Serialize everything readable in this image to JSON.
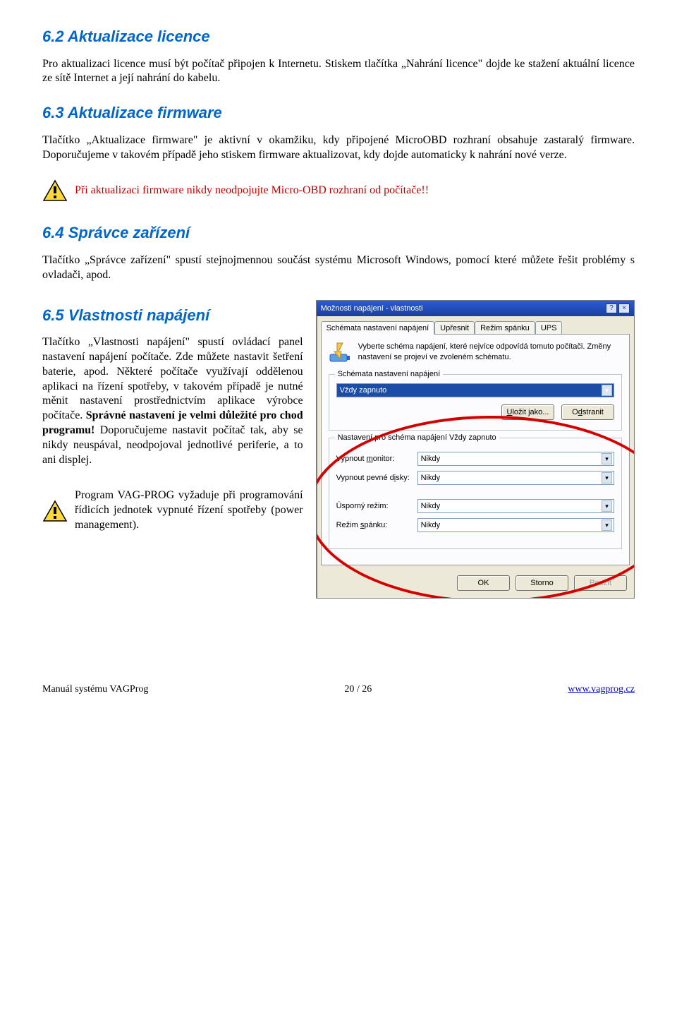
{
  "sections": {
    "s62": {
      "heading": "6.2   Aktualizace licence",
      "body": "Pro aktualizaci licence musí být počítač připojen k Internetu. Stiskem tlačítka „Nahrání licence\" dojde ke stažení aktuální licence ze sítě Internet a její nahrání do kabelu."
    },
    "s63": {
      "heading": "6.3   Aktualizace firmware",
      "body": "Tlačítko „Aktualizace firmware\" je aktivní v okamžiku, kdy připojené MicroOBD rozhraní obsahuje zastaralý firmware. Doporučujeme v takovém případě jeho stiskem firmware aktualizovat, kdy dojde automaticky k nahrání nové verze."
    },
    "warn1": "Při aktualizaci firmware nikdy neodpojujte Micro-OBD rozhraní od počítače!!",
    "s64": {
      "heading": "6.4   Správce zařízení",
      "body": "Tlačítko „Správce zařízení\" spustí stejnojmennou součást systému Microsoft Windows, pomocí které můžete řešit problémy s ovladači, apod."
    },
    "s65": {
      "heading": "6.5   Vlastnosti napájení",
      "body_a": "Tlačítko „Vlastnosti napájení\" spustí ovládací panel nastavení napájení počítače. Zde můžete nastavit šetření baterie, apod. Některé počítače využívají oddělenou aplikaci na řízení spotřeby, v takovém případě je nutné měnit nastavení prostřednictvím aplikace výrobce počítače. ",
      "body_b": "Správné nastavení je velmi důležité pro chod programu!",
      "body_c": " Doporučujeme nastavit počítač tak, aby se nikdy neuspával, neodpojoval jednotlivé periferie, a to ani displej."
    },
    "warn2": "Program VAG-PROG vyžaduje při programování řídicích jednotek vypnuté řízení spotřeby (power management)."
  },
  "dialog": {
    "title": "Možnosti napájení - vlastnosti",
    "help": "?",
    "close": "×",
    "tabs": [
      "Schémata nastavení napájení",
      "Upřesnit",
      "Režim spánku",
      "UPS"
    ],
    "info": "Vyberte schéma napájení, které nejvíce odpovídá tomuto počítači. Změny nastavení se projeví ve zvoleném schématu.",
    "group1_legend": "Schémata nastavení napájení",
    "scheme_value": "Vždy zapnuto",
    "btn_saveas": "Uložit jako...",
    "btn_delete": "Odstranit",
    "group2_legend": "Nastavení pro schéma napájení Vždy zapnuto",
    "rows": [
      {
        "label": "Vypnout monitor:",
        "value": "Nikdy"
      },
      {
        "label": "Vypnout pevné disky:",
        "value": "Nikdy"
      },
      {
        "label": "Úsporný režim:",
        "value": "Nikdy"
      },
      {
        "label": "Režim spánku:",
        "value": "Nikdy"
      }
    ],
    "ok": "OK",
    "cancel": "Storno",
    "apply": "Použít"
  },
  "footer": {
    "left": "Manuál systému VAGProg",
    "center": "20 / 26",
    "right": "www.vagprog.cz"
  }
}
